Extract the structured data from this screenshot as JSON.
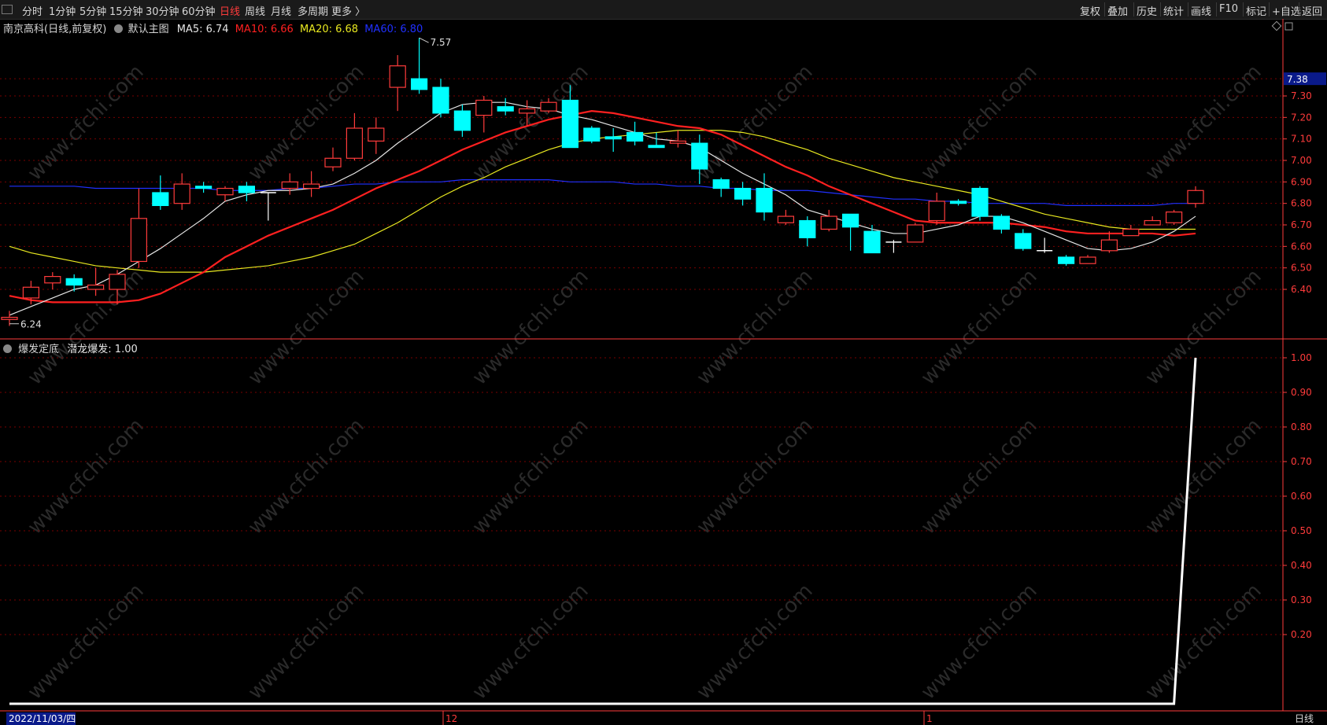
{
  "toolbar": {
    "periods": [
      "分时",
      "1分钟",
      "5分钟",
      "15分钟",
      "30分钟",
      "60分钟",
      "日线",
      "周线",
      "月线",
      "多周期",
      "更多 〉"
    ],
    "active_period": "日线",
    "right": [
      "复权",
      "叠加",
      "历史",
      "统计",
      "画线",
      "F10",
      "标记",
      "+自选",
      "返回"
    ]
  },
  "main_legend": {
    "title": "南京高科(日线,前复权)",
    "template": "默认主图",
    "ma5": "MA5: 6.74",
    "ma10": "MA10: 6.66",
    "ma20": "MA20: 6.68",
    "ma60": "MA60: 6.80"
  },
  "sub_legend": {
    "title": "爆发定底",
    "value": "潜龙爆发: 1.00"
  },
  "colors": {
    "up": "#ff3b3b",
    "down": "#00ffff",
    "ma5": "#e6e6e6",
    "ma10": "#ff2020",
    "ma20": "#e8e820",
    "ma60": "#2030ff",
    "grid": "#7a0000",
    "axis": "#ff3b3b"
  },
  "price_marks": {
    "high": "7.57",
    "low": "6.24",
    "last": "7.38"
  },
  "chart_data": [
    {
      "type": "candlestick",
      "title": "南京高科(日线,前复权)",
      "y_ticks": [
        "7.30",
        "7.20",
        "7.10",
        "7.00",
        "6.90",
        "6.80",
        "6.70",
        "6.60",
        "6.50",
        "6.40"
      ],
      "ylim": [
        6.2,
        7.6
      ],
      "x_labels": [
        "2022/11/03/四",
        "12",
        "1"
      ],
      "candles": [
        [
          6.26,
          6.27,
          6.3,
          6.23
        ],
        [
          6.36,
          6.41,
          6.44,
          6.33
        ],
        [
          6.43,
          6.46,
          6.48,
          6.4
        ],
        [
          6.45,
          6.42,
          6.47,
          6.39
        ],
        [
          6.4,
          6.42,
          6.5,
          6.37
        ],
        [
          6.4,
          6.47,
          6.49,
          6.33
        ],
        [
          6.53,
          6.73,
          6.87,
          6.5
        ],
        [
          6.85,
          6.79,
          6.93,
          6.77
        ],
        [
          6.8,
          6.89,
          6.94,
          6.77
        ],
        [
          6.88,
          6.87,
          6.9,
          6.85
        ],
        [
          6.84,
          6.87,
          6.88,
          6.81
        ],
        [
          6.88,
          6.85,
          6.9,
          6.81
        ],
        [
          6.85,
          6.85,
          6.85,
          6.72
        ],
        [
          6.87,
          6.9,
          6.94,
          6.84
        ],
        [
          6.87,
          6.89,
          6.95,
          6.83
        ],
        [
          6.97,
          7.01,
          7.06,
          6.95
        ],
        [
          7.01,
          7.15,
          7.22,
          7.0
        ],
        [
          7.09,
          7.15,
          7.2,
          7.03
        ],
        [
          7.34,
          7.44,
          7.49,
          7.23
        ],
        [
          7.38,
          7.33,
          7.57,
          7.31
        ],
        [
          7.34,
          7.22,
          7.38,
          7.2
        ],
        [
          7.23,
          7.14,
          7.26,
          7.11
        ],
        [
          7.21,
          7.28,
          7.3,
          7.13
        ],
        [
          7.25,
          7.23,
          7.29,
          7.21
        ],
        [
          7.22,
          7.24,
          7.28,
          7.16
        ],
        [
          7.23,
          7.27,
          7.29,
          7.22
        ],
        [
          7.28,
          7.06,
          7.35,
          7.06
        ],
        [
          7.15,
          7.09,
          7.16,
          7.08
        ],
        [
          7.11,
          7.1,
          7.15,
          7.04
        ],
        [
          7.13,
          7.09,
          7.18,
          7.07
        ],
        [
          7.07,
          7.06,
          7.13,
          7.06
        ],
        [
          7.08,
          7.09,
          7.14,
          7.06
        ],
        [
          7.08,
          6.96,
          7.12,
          6.89
        ],
        [
          6.91,
          6.87,
          6.92,
          6.83
        ],
        [
          6.87,
          6.82,
          6.9,
          6.79
        ],
        [
          6.87,
          6.76,
          6.94,
          6.72
        ],
        [
          6.71,
          6.74,
          6.77,
          6.7
        ],
        [
          6.72,
          6.64,
          6.74,
          6.6
        ],
        [
          6.68,
          6.74,
          6.77,
          6.67
        ],
        [
          6.75,
          6.69,
          6.75,
          6.58
        ],
        [
          6.67,
          6.57,
          6.7,
          6.57
        ],
        [
          6.62,
          6.62,
          6.63,
          6.57
        ],
        [
          6.62,
          6.7,
          6.71,
          6.62
        ],
        [
          6.72,
          6.81,
          6.85,
          6.7
        ],
        [
          6.81,
          6.8,
          6.82,
          6.79
        ],
        [
          6.87,
          6.74,
          6.88,
          6.72
        ],
        [
          6.74,
          6.68,
          6.75,
          6.66
        ],
        [
          6.66,
          6.59,
          6.68,
          6.58
        ],
        [
          6.58,
          6.58,
          6.64,
          6.57
        ],
        [
          6.55,
          6.52,
          6.56,
          6.51
        ],
        [
          6.52,
          6.55,
          6.56,
          6.52
        ],
        [
          6.58,
          6.63,
          6.67,
          6.57
        ],
        [
          6.65,
          6.68,
          6.7,
          6.65
        ],
        [
          6.7,
          6.72,
          6.74,
          6.7
        ],
        [
          6.71,
          6.76,
          6.77,
          6.7
        ],
        [
          6.8,
          6.86,
          6.88,
          6.78
        ]
      ],
      "ma5": [
        6.28,
        6.32,
        6.36,
        6.4,
        6.42,
        6.47,
        6.53,
        6.59,
        6.66,
        6.73,
        6.81,
        6.84,
        6.86,
        6.86,
        6.87,
        6.89,
        6.94,
        7.0,
        7.08,
        7.15,
        7.22,
        7.26,
        7.27,
        7.27,
        7.25,
        7.24,
        7.21,
        7.19,
        7.16,
        7.13,
        7.1,
        7.09,
        7.06,
        7.0,
        6.94,
        6.89,
        6.84,
        6.77,
        6.74,
        6.71,
        6.68,
        6.66,
        6.66,
        6.68,
        6.7,
        6.74,
        6.74,
        6.71,
        6.67,
        6.63,
        6.59,
        6.58,
        6.59,
        6.62,
        6.67,
        6.74
      ],
      "ma10": [
        6.37,
        6.35,
        6.34,
        6.34,
        6.34,
        6.34,
        6.35,
        6.38,
        6.43,
        6.48,
        6.55,
        6.6,
        6.65,
        6.69,
        6.73,
        6.77,
        6.82,
        6.87,
        6.91,
        6.95,
        7.0,
        7.05,
        7.09,
        7.13,
        7.16,
        7.19,
        7.21,
        7.23,
        7.22,
        7.2,
        7.18,
        7.16,
        7.15,
        7.12,
        7.07,
        7.02,
        6.97,
        6.93,
        6.88,
        6.84,
        6.8,
        6.76,
        6.72,
        6.71,
        6.71,
        6.71,
        6.71,
        6.7,
        6.69,
        6.67,
        6.66,
        6.66,
        6.66,
        6.66,
        6.65,
        6.66
      ],
      "ma20": [
        6.6,
        6.57,
        6.55,
        6.53,
        6.51,
        6.5,
        6.49,
        6.48,
        6.48,
        6.48,
        6.49,
        6.5,
        6.51,
        6.53,
        6.55,
        6.58,
        6.61,
        6.66,
        6.71,
        6.77,
        6.83,
        6.88,
        6.92,
        6.97,
        7.01,
        7.05,
        7.08,
        7.1,
        7.11,
        7.12,
        7.13,
        7.14,
        7.14,
        7.14,
        7.13,
        7.11,
        7.08,
        7.05,
        7.01,
        6.98,
        6.95,
        6.92,
        6.9,
        6.88,
        6.86,
        6.84,
        6.81,
        6.78,
        6.75,
        6.73,
        6.71,
        6.69,
        6.68,
        6.68,
        6.68,
        6.68
      ],
      "ma60": [
        6.88,
        6.88,
        6.88,
        6.88,
        6.87,
        6.87,
        6.87,
        6.87,
        6.87,
        6.87,
        6.86,
        6.86,
        6.86,
        6.87,
        6.87,
        6.88,
        6.89,
        6.89,
        6.9,
        6.9,
        6.9,
        6.91,
        6.91,
        6.91,
        6.91,
        6.91,
        6.9,
        6.9,
        6.9,
        6.89,
        6.89,
        6.88,
        6.88,
        6.87,
        6.87,
        6.86,
        6.86,
        6.86,
        6.85,
        6.84,
        6.83,
        6.82,
        6.82,
        6.81,
        6.81,
        6.8,
        6.8,
        6.8,
        6.8,
        6.79,
        6.79,
        6.79,
        6.79,
        6.79,
        6.8,
        6.8
      ]
    },
    {
      "type": "line",
      "title": "爆发定底",
      "series": [
        {
          "name": "潜龙爆发",
          "values": [
            0,
            0,
            0,
            0,
            0,
            0,
            0,
            0,
            0,
            0,
            0,
            0,
            0,
            0,
            0,
            0,
            0,
            0,
            0,
            0,
            0,
            0,
            0,
            0,
            0,
            0,
            0,
            0,
            0,
            0,
            0,
            0,
            0,
            0,
            0,
            0,
            0,
            0,
            0,
            0,
            0,
            0,
            0,
            0,
            0,
            0,
            0,
            0,
            0,
            0,
            0,
            0,
            0,
            0,
            0,
            1.0
          ]
        }
      ],
      "y_ticks": [
        "1.00",
        "0.90",
        "0.80",
        "0.70",
        "0.60",
        "0.50",
        "0.40",
        "0.30",
        "0.20"
      ],
      "ylim": [
        0,
        1.0
      ]
    }
  ]
}
